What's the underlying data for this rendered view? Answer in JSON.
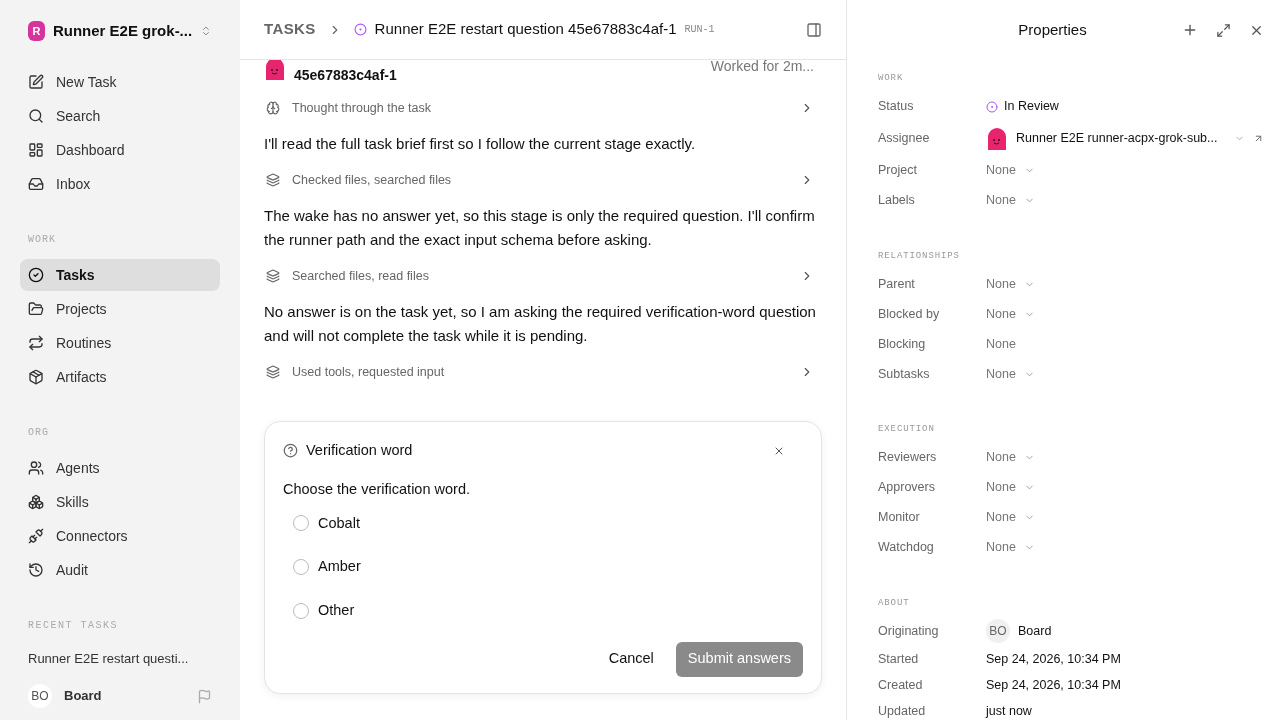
{
  "workspace": {
    "initial": "R",
    "name": "Runner E2E grok-..."
  },
  "sidebar": {
    "nav": [
      {
        "label": "New Task",
        "selected": false
      },
      {
        "label": "Search",
        "selected": false
      },
      {
        "label": "Dashboard",
        "selected": false
      },
      {
        "label": "Inbox",
        "selected": false
      }
    ],
    "sections": [
      {
        "title": "WORK",
        "items": [
          {
            "label": "Tasks",
            "selected": true
          },
          {
            "label": "Projects",
            "selected": false
          },
          {
            "label": "Routines",
            "selected": false
          },
          {
            "label": "Artifacts",
            "selected": false
          }
        ]
      },
      {
        "title": "ORG",
        "items": [
          {
            "label": "Agents",
            "selected": false
          },
          {
            "label": "Skills",
            "selected": false
          },
          {
            "label": "Connectors",
            "selected": false
          },
          {
            "label": "Audit",
            "selected": false
          }
        ]
      }
    ],
    "recent_title": "RECENT TASKS",
    "recent": [
      "Runner E2E restart questi..."
    ],
    "user": {
      "initials": "BO",
      "name": "Board"
    }
  },
  "breadcrumb": {
    "root": "TASKS",
    "title": "Runner E2E restart question 45e67883c4af-1",
    "run": "RUN-1"
  },
  "agent": {
    "name": "45e67883c4af-1",
    "worked": "Worked for 2m..."
  },
  "transcript": [
    {
      "kind": "thinking",
      "text": "Thought through the task"
    },
    {
      "kind": "message",
      "text": "I'll read the full task brief first so I follow the current stage exactly."
    },
    {
      "kind": "tools",
      "text": "Checked files, searched files"
    },
    {
      "kind": "message",
      "text": "The wake has no answer yet, so this stage is only the required question. I'll confirm the runner path and the exact input schema before asking."
    },
    {
      "kind": "tools",
      "text": "Searched files, read files"
    },
    {
      "kind": "message",
      "text": "No answer is on the task yet, so I am asking the required verification-word question and will not complete the task while it is pending."
    },
    {
      "kind": "tools",
      "text": "Used tools, requested input"
    }
  ],
  "question": {
    "title": "Verification word",
    "prompt": "Choose the verification word.",
    "options": [
      {
        "label": "Cobalt",
        "selected": false
      },
      {
        "label": "Amber",
        "selected": false
      },
      {
        "label": "Other",
        "selected": false
      }
    ],
    "cancel": "Cancel",
    "submit": "Submit answers",
    "submit_disabled": true
  },
  "properties": {
    "title": "Properties",
    "sections": [
      {
        "title": "WORK",
        "rows": [
          {
            "label": "Status",
            "kind": "status",
            "value": "In Review"
          },
          {
            "label": "Assignee",
            "kind": "agent",
            "value": "Runner E2E runner-acpx-grok-sub..."
          },
          {
            "label": "Project",
            "kind": "select",
            "value": "None"
          },
          {
            "label": "Labels",
            "kind": "select",
            "value": "None"
          }
        ]
      },
      {
        "title": "RELATIONSHIPS",
        "rows": [
          {
            "label": "Parent",
            "kind": "select",
            "value": "None"
          },
          {
            "label": "Blocked by",
            "kind": "select",
            "value": "None"
          },
          {
            "label": "Blocking",
            "kind": "text",
            "value": "None"
          },
          {
            "label": "Subtasks",
            "kind": "select",
            "value": "None"
          }
        ]
      },
      {
        "title": "EXECUTION",
        "rows": [
          {
            "label": "Reviewers",
            "kind": "select",
            "value": "None"
          },
          {
            "label": "Approvers",
            "kind": "select",
            "value": "None"
          },
          {
            "label": "Monitor",
            "kind": "select",
            "value": "None"
          },
          {
            "label": "Watchdog",
            "kind": "select",
            "value": "None"
          }
        ]
      },
      {
        "title": "ABOUT",
        "rows": [
          {
            "label": "Originating",
            "kind": "user",
            "initials": "BO",
            "value": "Board"
          },
          {
            "label": "Started",
            "kind": "date",
            "value": "Sep 24, 2026, 10:34 PM"
          },
          {
            "label": "Created",
            "kind": "date",
            "value": "Sep 24, 2026, 10:34 PM"
          },
          {
            "label": "Updated",
            "kind": "date",
            "value": "just now"
          }
        ]
      }
    ]
  }
}
